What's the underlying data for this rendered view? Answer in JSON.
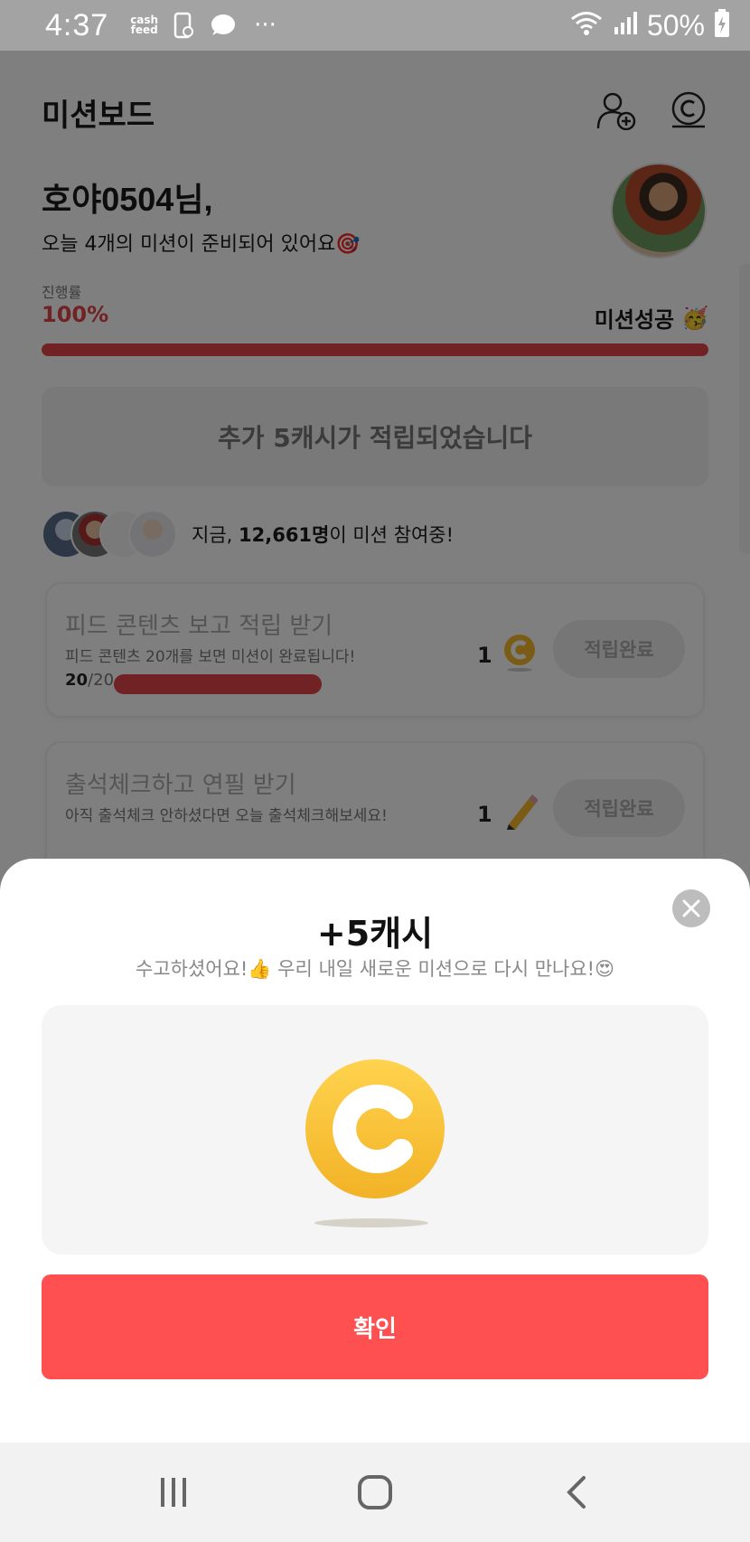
{
  "status_bar": {
    "time": "4:37",
    "app_badge_line1": "cash",
    "app_badge_line2": "feed",
    "more": "···",
    "battery": "50%"
  },
  "header": {
    "title": "미션보드",
    "icons": [
      "add-friend-icon",
      "cash-coin-icon"
    ]
  },
  "greeting": {
    "name": "호야0504님,",
    "subtitle": "오늘 4개의 미션이 준비되어 있어요🎯"
  },
  "progress": {
    "label": "진행률",
    "value_text": "100%",
    "fraction": 1.0,
    "status": "미션성공",
    "status_emoji": "🥳"
  },
  "bonus_banner": "추가 5캐시가 적립되었습니다",
  "participants": {
    "prefix": "지금, ",
    "count": "12,661명",
    "suffix": "이 미션 참여중!"
  },
  "missions": [
    {
      "title": "피드 콘텐츠 보고 적립 받기",
      "description": "피드 콘텐츠 20개를 보면 미션이 완료됩니다!",
      "count_done": "20",
      "count_total": "/20",
      "progress": 1.0,
      "reward_amount": "1",
      "reward_icon": "cash-coin-icon",
      "button": "적립완료"
    },
    {
      "title": "출석체크하고 연필 받기",
      "description": "아직 출석체크 안하셨다면 오늘 출석체크해보세요!",
      "reward_amount": "1",
      "reward_icon": "pencil-icon",
      "button": "적립완료"
    }
  ],
  "sheet": {
    "title": "+5캐시",
    "subtitle": "수고하셨어요!👍 우리 내일 새로운 미션으로 다시 만나요!😍",
    "confirm": "확인"
  },
  "colors": {
    "accent": "#fe5050",
    "progress": "#e0444a",
    "coin": "#f5b82e"
  }
}
